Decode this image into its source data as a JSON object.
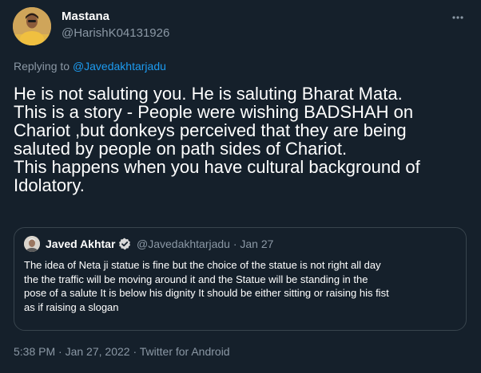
{
  "author": {
    "display_name": "Mastana",
    "handle": "@HarishK04131926"
  },
  "more_icon": "more-horizontal-icon",
  "reply_context": {
    "prefix": "Replying to ",
    "mention": "@Javedakhtarjadu"
  },
  "tweet_lines": [
    "He is not saluting you. He is saluting Bharat Mata.",
    "This is a story - People were wishing BADSHAH on",
    "Chariot ,but donkeys perceived that they are being",
    "saluted by people on path sides of Chariot.",
    "This happens when you have cultural background of",
    "Idolatory."
  ],
  "quoted": {
    "display_name": "Javed Akhtar",
    "verified_icon": "verified-badge-icon",
    "handle_date": "@Javedakhtarjadu · Jan 27",
    "lines": [
      "The idea of Neta ji statue is fine but the choice of the statue is not right  all day",
      "the the traffic will be moving around it and the Statue  will be standing in the",
      "pose of a salute It is below his dignity It should be either sitting or raising his fist",
      "as if raising a slogan"
    ]
  },
  "meta": {
    "time": "5:38 PM",
    "separator1": " · ",
    "date": "Jan 27, 2022",
    "separator2": " · ",
    "source": "Twitter for Android"
  },
  "colors": {
    "background": "#15202b",
    "text": "#ffffff",
    "secondary": "#8b98a5",
    "link": "#1d9bf0",
    "border": "#38444d"
  }
}
